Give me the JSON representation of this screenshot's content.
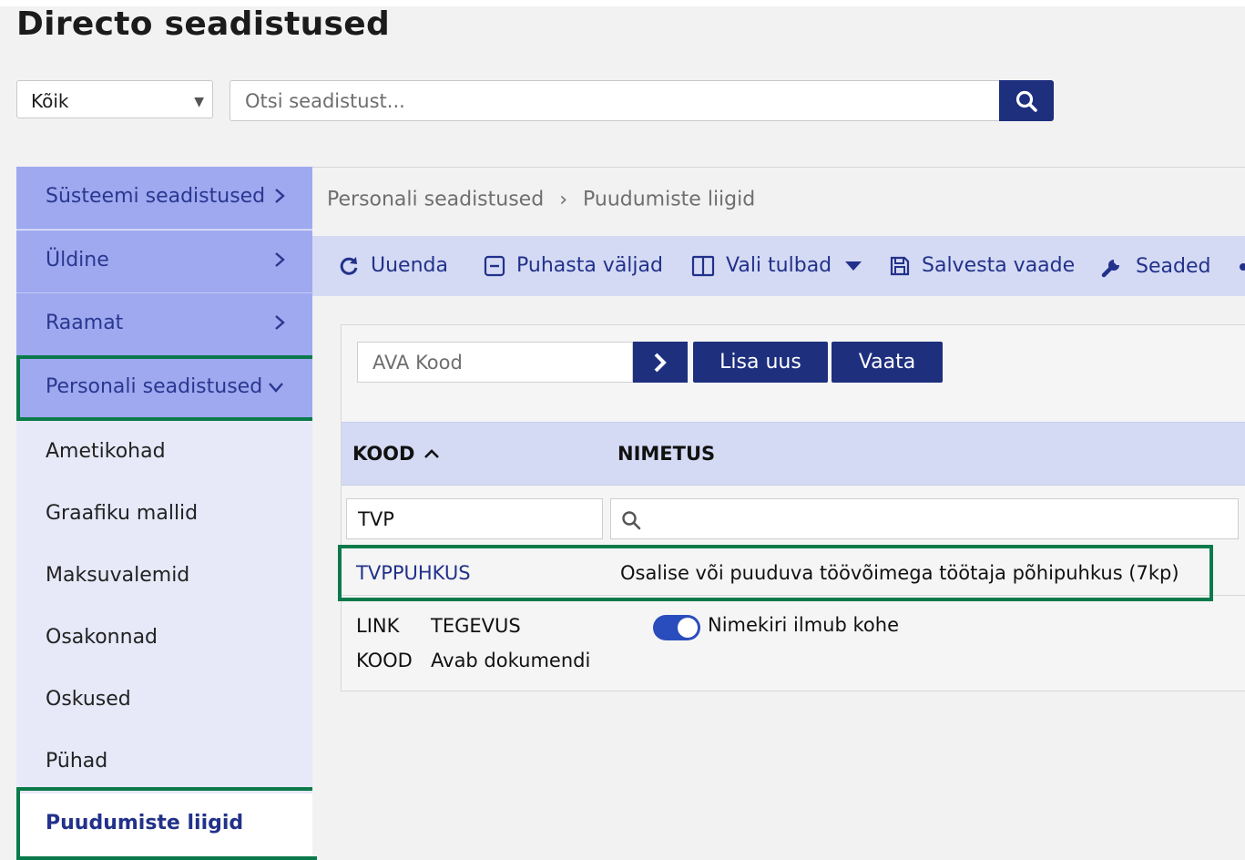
{
  "page_title": "Directo seadistused",
  "category_select": {
    "value": "Kõik"
  },
  "search": {
    "placeholder": "Otsi seadistust..."
  },
  "sidebar": {
    "items": [
      {
        "label": "Süsteemi seadistused"
      },
      {
        "label": "Üldine"
      },
      {
        "label": "Raamat"
      },
      {
        "label": "Personali seadistused"
      },
      {
        "label": "Ametikohad"
      },
      {
        "label": "Graafiku mallid"
      },
      {
        "label": "Maksuvalemid"
      },
      {
        "label": "Osakonnad"
      },
      {
        "label": "Oskused"
      },
      {
        "label": "Pühad"
      },
      {
        "label": "Puudumiste liigid"
      }
    ]
  },
  "breadcrumb": {
    "parent": "Personali seadistused",
    "current": "Puudumiste liigid"
  },
  "toolbar": {
    "refresh": "Uuenda",
    "clear_fields": "Puhasta väljad",
    "choose_columns": "Vali tulbad",
    "save_view": "Salvesta vaade",
    "settings": "Seaded"
  },
  "open_code": {
    "placeholder": "AVA Kood"
  },
  "buttons": {
    "add_new": "Lisa uus",
    "view": "Vaata"
  },
  "table": {
    "columns": [
      {
        "label": "KOOD"
      },
      {
        "label": "NIMETUS"
      }
    ],
    "filters": {
      "kood": "TVP",
      "nimetus": ""
    },
    "rows": [
      {
        "kood": "TVPPUHKUS",
        "nimetus": "Osalise või puuduva töövõimega töötaja põhipuhkus (7kp)"
      }
    ]
  },
  "legend": {
    "link_label": "LINK",
    "link_value": "TEGEVUS",
    "kood_label": "KOOD",
    "kood_value": "Avab dokumendi",
    "toggle_label": "Nimekiri ilmub kohe"
  },
  "colors": {
    "accent": "#1e2f7e",
    "sidebar_dark": "#9ea9ef",
    "sidebar_light": "#e7e9f9",
    "toolbar_bg": "#d4daf4",
    "highlight": "#0a7a4b",
    "toggle_on": "#2a4dbd"
  }
}
